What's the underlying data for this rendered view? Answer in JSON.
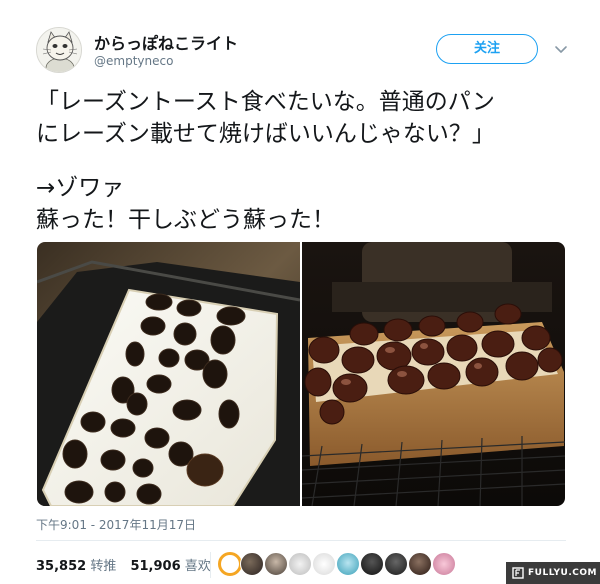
{
  "tweet": {
    "display_name": "からっぽねこライト",
    "handle": "@emptyneco",
    "follow_label": "关注",
    "text_lines": [
      "「レーズントースト食べたいな。普通のパン",
      "にレーズン載せて焼けばいいんじゃない？」",
      "",
      "→ゾワァ",
      "蘇った！干しぶどう蘇った！"
    ],
    "timestamp": "下午9:01 - 2017年11月17日",
    "retweets_count": "35,852",
    "retweets_label": "转推",
    "likes_count": "51,906",
    "likes_label": "喜欢"
  },
  "watermark": {
    "text": "FULLYU.COM"
  },
  "colors": {
    "accent": "#1da1f2",
    "text": "#14171a",
    "secondary": "#657786"
  },
  "icons": {
    "avatar": "cat-avatar-icon",
    "caret": "chevron-down-icon"
  }
}
